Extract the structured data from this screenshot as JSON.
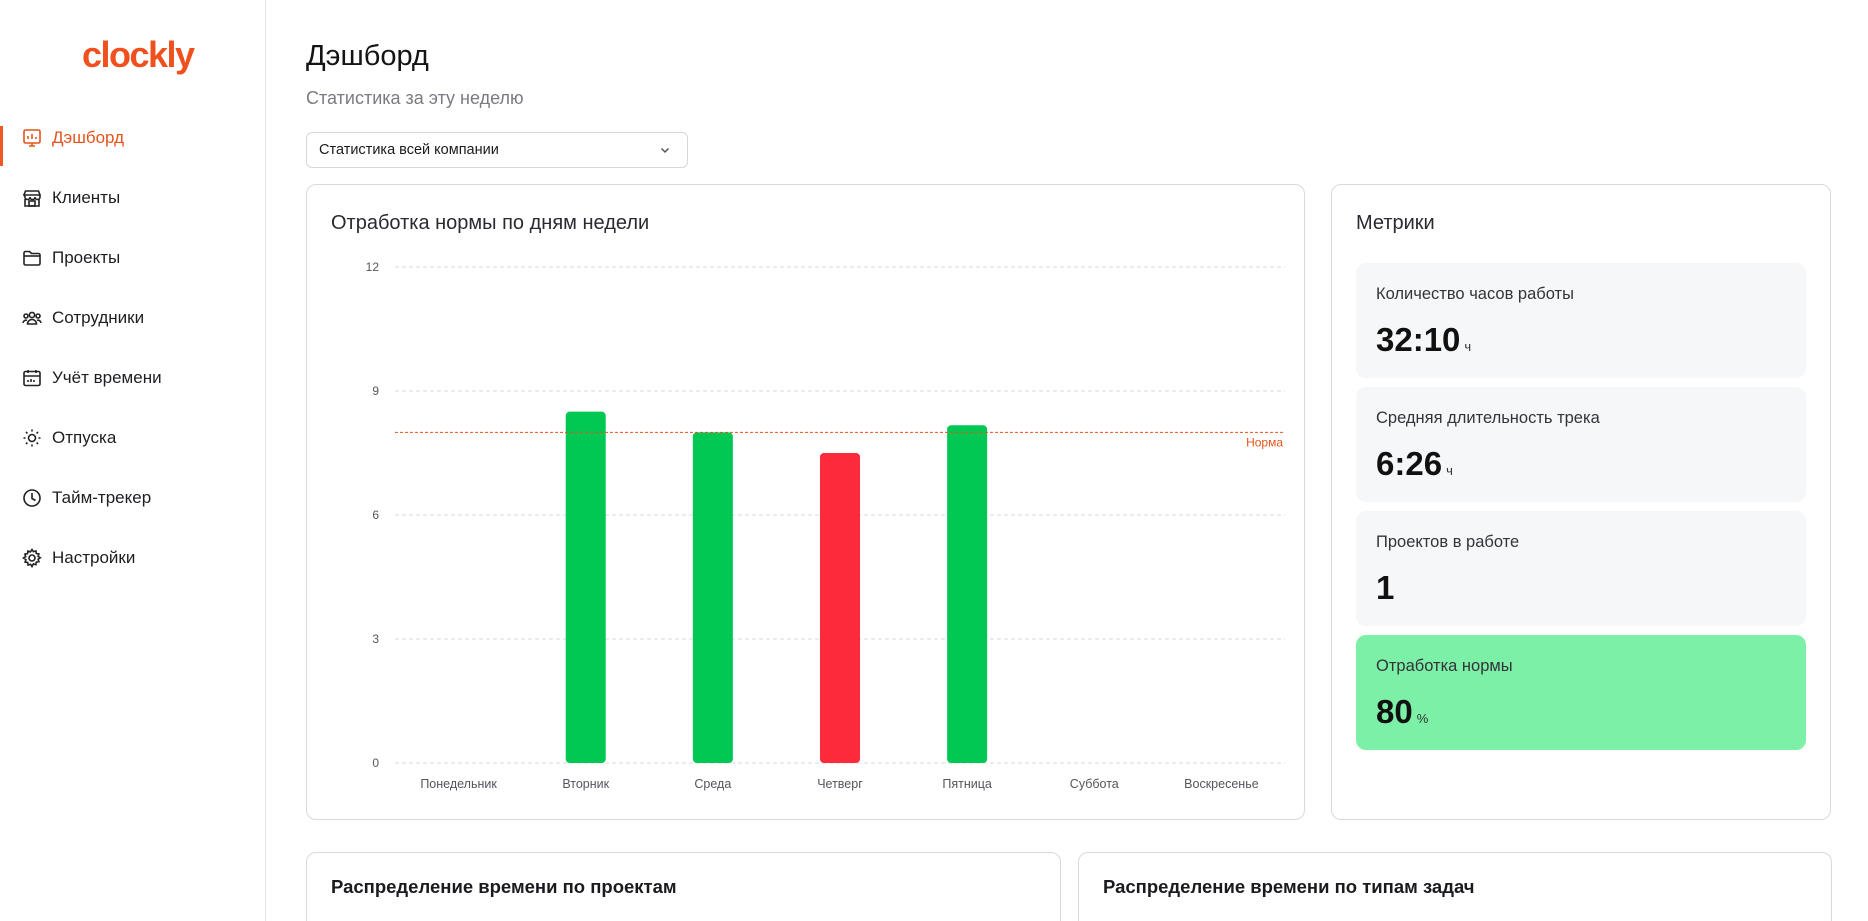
{
  "app": {
    "logo_text": "clockly"
  },
  "sidebar": {
    "items": [
      {
        "label": "Дэшборд",
        "icon": "dashboard-icon",
        "active": true
      },
      {
        "label": "Клиенты",
        "icon": "store-icon"
      },
      {
        "label": "Проекты",
        "icon": "folder-icon"
      },
      {
        "label": "Сотрудники",
        "icon": "team-icon"
      },
      {
        "label": "Учёт времени",
        "icon": "calendar-icon"
      },
      {
        "label": "Отпуска",
        "icon": "sun-icon"
      },
      {
        "label": "Тайм-трекер",
        "icon": "clock-icon"
      },
      {
        "label": "Настройки",
        "icon": "gear-icon"
      }
    ]
  },
  "header": {
    "title": "Дэшборд",
    "subtitle": "Статистика за эту неделю"
  },
  "filter": {
    "selected": "Статистика всей компании"
  },
  "chart_card": {
    "title": "Отработка нормы по дням недели"
  },
  "chart_data": {
    "type": "bar",
    "categories": [
      "Понедельник",
      "Вторник",
      "Среда",
      "Четверг",
      "Пятница",
      "Суббота",
      "Воскресенье"
    ],
    "values": [
      0,
      8.5,
      8,
      7.5,
      8.17,
      0,
      0
    ],
    "bar_status": [
      "none",
      "ok",
      "ok",
      "below",
      "ok",
      "none",
      "none"
    ],
    "yticks": [
      0,
      3,
      6,
      9,
      12
    ],
    "ylim": [
      0,
      12
    ],
    "norm": {
      "value": 8,
      "label": "Норма"
    },
    "colors": {
      "ok": "#00c853",
      "below": "#fc2b3b",
      "norm": "#e5531c",
      "grid": "#d8d8dc"
    },
    "grid": true
  },
  "metrics": {
    "title": "Метрики",
    "items": [
      {
        "label": "Количество часов работы",
        "value": "32:10",
        "unit": "ч"
      },
      {
        "label": "Средняя длительность трека",
        "value": "6:26",
        "unit": "ч"
      },
      {
        "label": "Проектов в работе",
        "value": "1",
        "unit": ""
      },
      {
        "label": "Отработка нормы",
        "value": "80",
        "unit": "%",
        "highlight": true
      }
    ]
  },
  "bottom": {
    "projects_title": "Распределение времени по проектам",
    "task_types_title": "Распределение времени по типам задач"
  },
  "accent_color": "#ef5a24"
}
